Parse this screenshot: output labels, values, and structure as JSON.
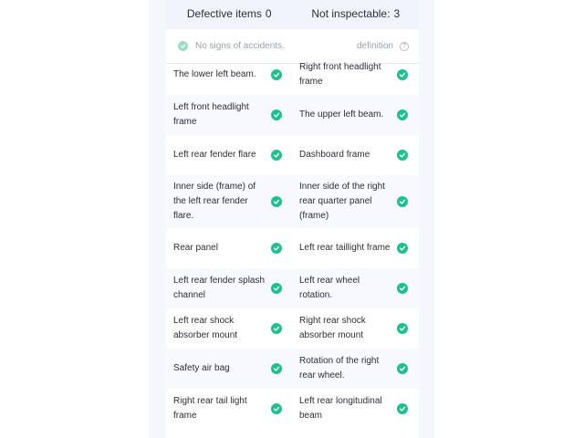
{
  "summary": {
    "defective_label": "Defective items",
    "defective_count": "0",
    "not_inspectable_label": "Not inspectable:",
    "not_inspectable_count": "3"
  },
  "status": {
    "text": "No signs of accidents.",
    "definition_label": "definition",
    "info_icon": "?"
  },
  "items": [
    [
      "The lower left beam.",
      "Right front headlight frame"
    ],
    [
      "Left front headlight frame",
      "The upper left beam."
    ],
    [
      "Left rear fender flare",
      "Dashboard frame"
    ],
    [
      "Inner side (frame) of the left rear fender flare.",
      "Inner side of the right rear quarter panel (frame)"
    ],
    [
      "Rear panel",
      "Left rear taillight frame"
    ],
    [
      "Left rear fender splash channel",
      "Left rear wheel rotation."
    ],
    [
      "Left rear shock absorber mount",
      "Right rear shock absorber mount"
    ],
    [
      "Safety air bag",
      "Rotation of the right rear wheel."
    ],
    [
      "Right rear tail light frame",
      "Left rear longitudinal beam"
    ]
  ],
  "colors": {
    "accent_green": "#1fbf8f",
    "summary_bg": "#f0f5fd",
    "panel_bg": "#f4f7fb"
  },
  "icons": {
    "item_status": "check-circle-icon",
    "status_bar": "check-circle-icon",
    "definition": "question-circle-icon"
  }
}
